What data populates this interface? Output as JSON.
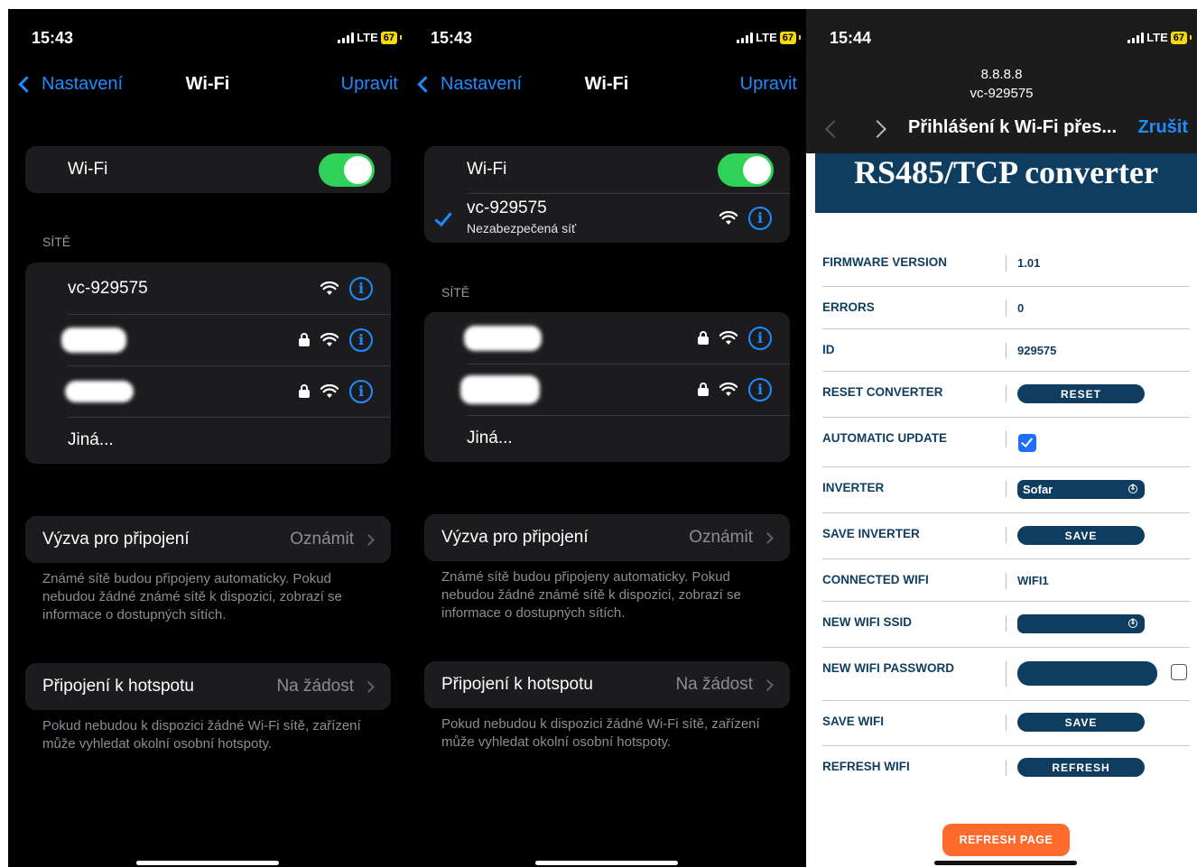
{
  "panel1": {
    "status": {
      "time": "15:43",
      "network": "LTE",
      "battery": "67"
    },
    "nav": {
      "back": "Nastavení",
      "title": "Wi-Fi",
      "action": "Upravit"
    },
    "wifi_label": "Wi-Fi",
    "networks_header": "SÍTĚ",
    "networks": [
      {
        "name": "vc-929575"
      }
    ],
    "other": "Jiná...",
    "join_prompt": {
      "label": "Výzva pro připojení",
      "value": "Oznámit"
    },
    "join_note": "Známé sítě budou připojeny automaticky. Pokud nebudou žádné známé sítě k dispozici, zobrazí se informace o dostupných sítích.",
    "hotspot": {
      "label": "Připojení k hotspotu",
      "value": "Na žádost"
    },
    "hotspot_note": "Pokud nebudou k dispozici žádné Wi-Fi sítě, zařízení může vyhledat okolní osobní hotspoty."
  },
  "panel2": {
    "status": {
      "time": "15:43",
      "network": "LTE",
      "battery": "67"
    },
    "nav": {
      "back": "Nastavení",
      "title": "Wi-Fi",
      "action": "Upravit"
    },
    "wifi_label": "Wi-Fi",
    "connected": {
      "name": "vc-929575",
      "subtitle": "Nezabezpečená síť"
    },
    "networks_header": "SÍTĚ",
    "other": "Jiná...",
    "join_prompt": {
      "label": "Výzva pro připojení",
      "value": "Oznámit"
    },
    "join_note": "Známé sítě budou připojeny automaticky. Pokud nebudou žádné známé sítě k dispozici, zobrazí se informace o dostupných sítích.",
    "hotspot": {
      "label": "Připojení k hotspotu",
      "value": "Na žádost"
    },
    "hotspot_note": "Pokud nebudou k dispozici žádné Wi-Fi sítě, zařízení může vyhledat okolní osobní hotspoty."
  },
  "panel3": {
    "status": {
      "time": "15:44",
      "network": "LTE",
      "battery": "67"
    },
    "url_line1": "8.8.8.8",
    "url_line2": "vc-929575",
    "title": "Přihlášení k Wi-Fi přes...",
    "cancel": "Zrušit",
    "banner": "RS485/TCP converter",
    "rows": {
      "firmware": {
        "key": "FIRMWARE VERSION",
        "value": "1.01"
      },
      "errors": {
        "key": "ERRORS",
        "value": "0"
      },
      "id": {
        "key": "ID",
        "value": "929575"
      },
      "reset": {
        "key": "RESET CONVERTER",
        "button": "RESET"
      },
      "auto_update": {
        "key": "AUTOMATIC UPDATE",
        "checked": true
      },
      "inverter": {
        "key": "INVERTER",
        "selected": "Sofar"
      },
      "save_inverter": {
        "key": "SAVE INVERTER",
        "button": "SAVE"
      },
      "connected_wifi": {
        "key": "CONNECTED WIFI",
        "value": "WIFI1"
      },
      "new_ssid": {
        "key": "NEW WIFI SSID",
        "selected": ""
      },
      "new_password": {
        "key": "NEW WIFI PASSWORD"
      },
      "save_wifi": {
        "key": "SAVE WIFI",
        "button": "SAVE"
      },
      "refresh_wifi": {
        "key": "REFRESH WIFI",
        "button": "REFRESH"
      }
    },
    "refresh_page": "REFRESH PAGE"
  },
  "colors": {
    "ios_blue": "#1e8bff",
    "toggle_green": "#30d158",
    "converter_navy": "#0f3d5f",
    "refresh_orange": "#ff6b2c"
  }
}
